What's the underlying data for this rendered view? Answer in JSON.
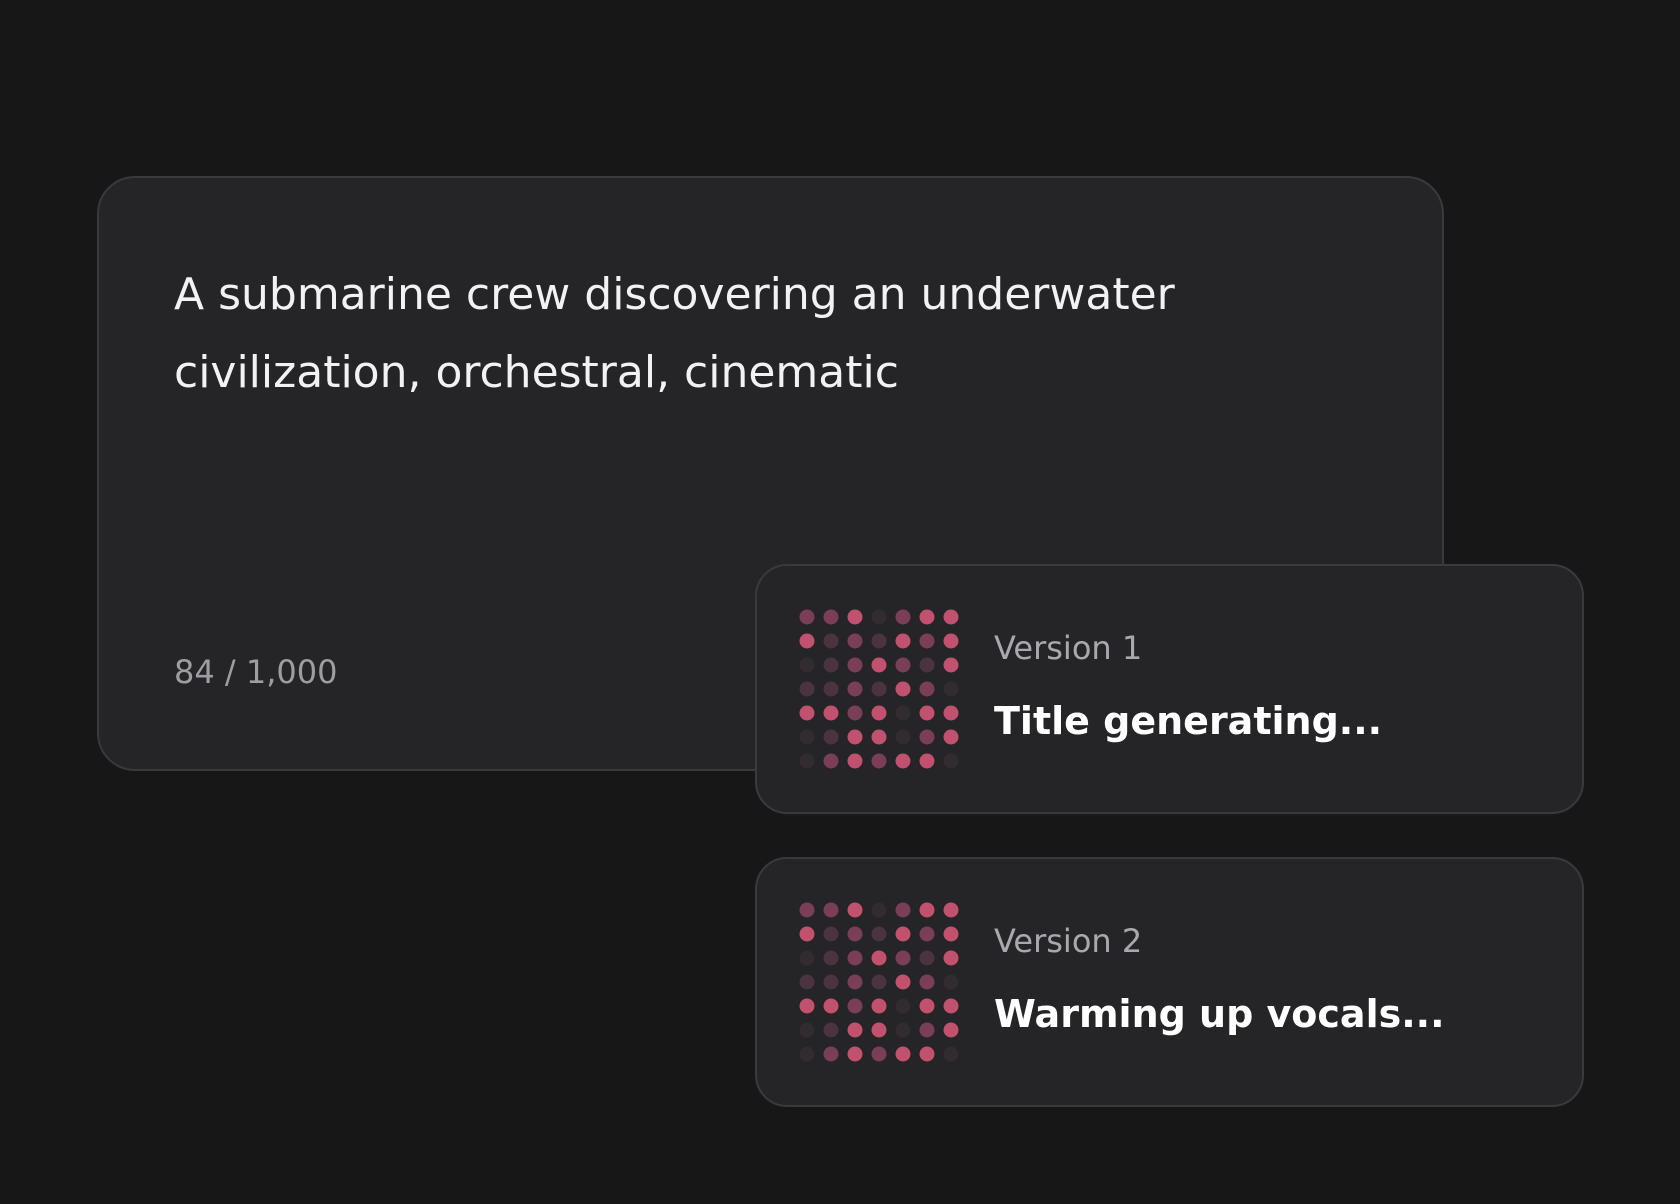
{
  "prompt": {
    "text": "A submarine crew discovering an underwater civilization, orchestral, cinematic",
    "char_count": "84 / 1,000"
  },
  "versions": [
    {
      "label": "Version 1",
      "status": "Title generating...",
      "pattern": [
        [
          2,
          2,
          3,
          0,
          2,
          3,
          3
        ],
        [
          3,
          1,
          2,
          1,
          3,
          2,
          3
        ],
        [
          0,
          1,
          2,
          3,
          2,
          1,
          3
        ],
        [
          1,
          1,
          2,
          1,
          3,
          2,
          0
        ],
        [
          3,
          3,
          2,
          3,
          0,
          3,
          3
        ],
        [
          0,
          1,
          3,
          3,
          0,
          2,
          3
        ],
        [
          0,
          2,
          3,
          2,
          3,
          3,
          0
        ]
      ]
    },
    {
      "label": "Version 2",
      "status": "Warming up vocals...",
      "pattern": [
        [
          2,
          2,
          3,
          0,
          2,
          3,
          3
        ],
        [
          3,
          1,
          2,
          1,
          3,
          2,
          3
        ],
        [
          0,
          1,
          2,
          3,
          2,
          1,
          3
        ],
        [
          1,
          1,
          2,
          1,
          3,
          2,
          0
        ],
        [
          3,
          3,
          2,
          3,
          0,
          3,
          3
        ],
        [
          0,
          1,
          3,
          3,
          0,
          2,
          3
        ],
        [
          0,
          2,
          3,
          2,
          3,
          3,
          0
        ]
      ]
    }
  ],
  "colors": {
    "background": "#171717",
    "card": "#252426",
    "border": "#3a393c",
    "dot_levels": [
      "#322b30",
      "#4b3340",
      "#7a3f57",
      "#c2506f"
    ]
  },
  "icons": {
    "version_art": "dot-matrix-waveform-icon"
  }
}
